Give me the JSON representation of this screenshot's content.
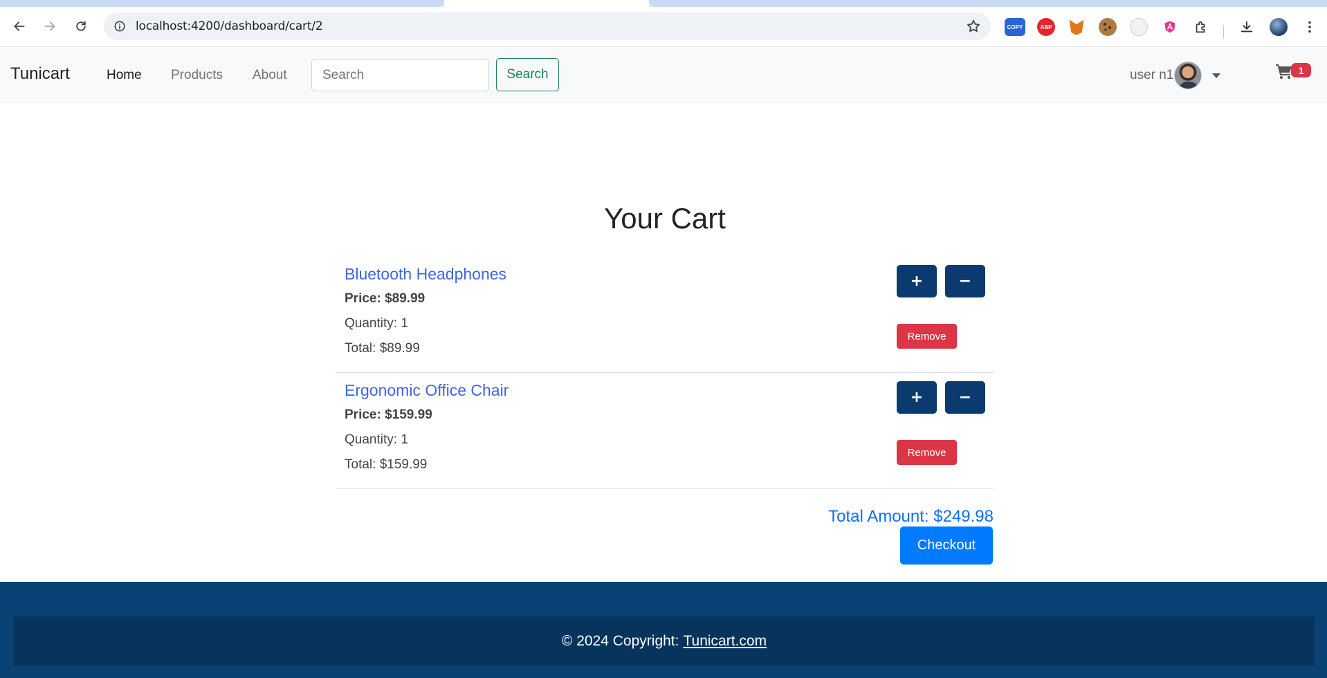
{
  "browser": {
    "url": "localhost:4200/dashboard/cart/2",
    "icons": [
      "back-icon",
      "forward-icon",
      "reload-icon",
      "site-info-icon",
      "bookmark-star-icon",
      "downloads-icon",
      "profile-icon",
      "more-menu-icon"
    ],
    "extensions": [
      {
        "name": "copy-extension-icon",
        "label": "COPY",
        "color": "#2b63d9"
      },
      {
        "name": "adblock-plus-icon",
        "label": "ABP",
        "color": "#e3262d"
      },
      {
        "name": "metamask-icon",
        "label": "",
        "color": "#e2761b"
      },
      {
        "name": "cookie-icon",
        "label": "",
        "color": "#8b5a2b"
      },
      {
        "name": "clock-extension-icon",
        "label": "",
        "color": "#dddddd"
      },
      {
        "name": "angular-devtools-icon",
        "label": "",
        "color": "#e23a8f"
      },
      {
        "name": "extensions-puzzle-icon",
        "label": "",
        "color": "#444444"
      }
    ]
  },
  "navbar": {
    "brand": "Tunicart",
    "links": [
      "Home",
      "Products",
      "About"
    ],
    "search_placeholder": "Search",
    "search_button": "Search",
    "user_name": "user n1",
    "cart_count": "1"
  },
  "cart": {
    "title": "Your Cart",
    "items": [
      {
        "name": "Bluetooth Headphones",
        "price": "Price: $89.99",
        "quantity": "Quantity: 1",
        "total": "Total: $89.99"
      },
      {
        "name": "Ergonomic Office Chair",
        "price": "Price: $159.99",
        "quantity": "Quantity: 1",
        "total": "Total: $159.99"
      }
    ],
    "plus_label": "+",
    "minus_label": "−",
    "remove_label": "Remove",
    "total_amount": "Total Amount: $249.98",
    "checkout_label": "Checkout"
  },
  "footer": {
    "copyright": "© 2024 Copyright:",
    "link_text": "Tunicart.com"
  },
  "colors": {
    "navbar_bg": "#f8f9fa",
    "item_link": "#3d65e5",
    "qty_button": "#0b3a6e",
    "remove_button": "#dc3545",
    "total_amount": "#0d6efd",
    "checkout_button": "#007bff",
    "footer_bg": "#0b4275",
    "footer_inner_bg": "#07345d"
  }
}
